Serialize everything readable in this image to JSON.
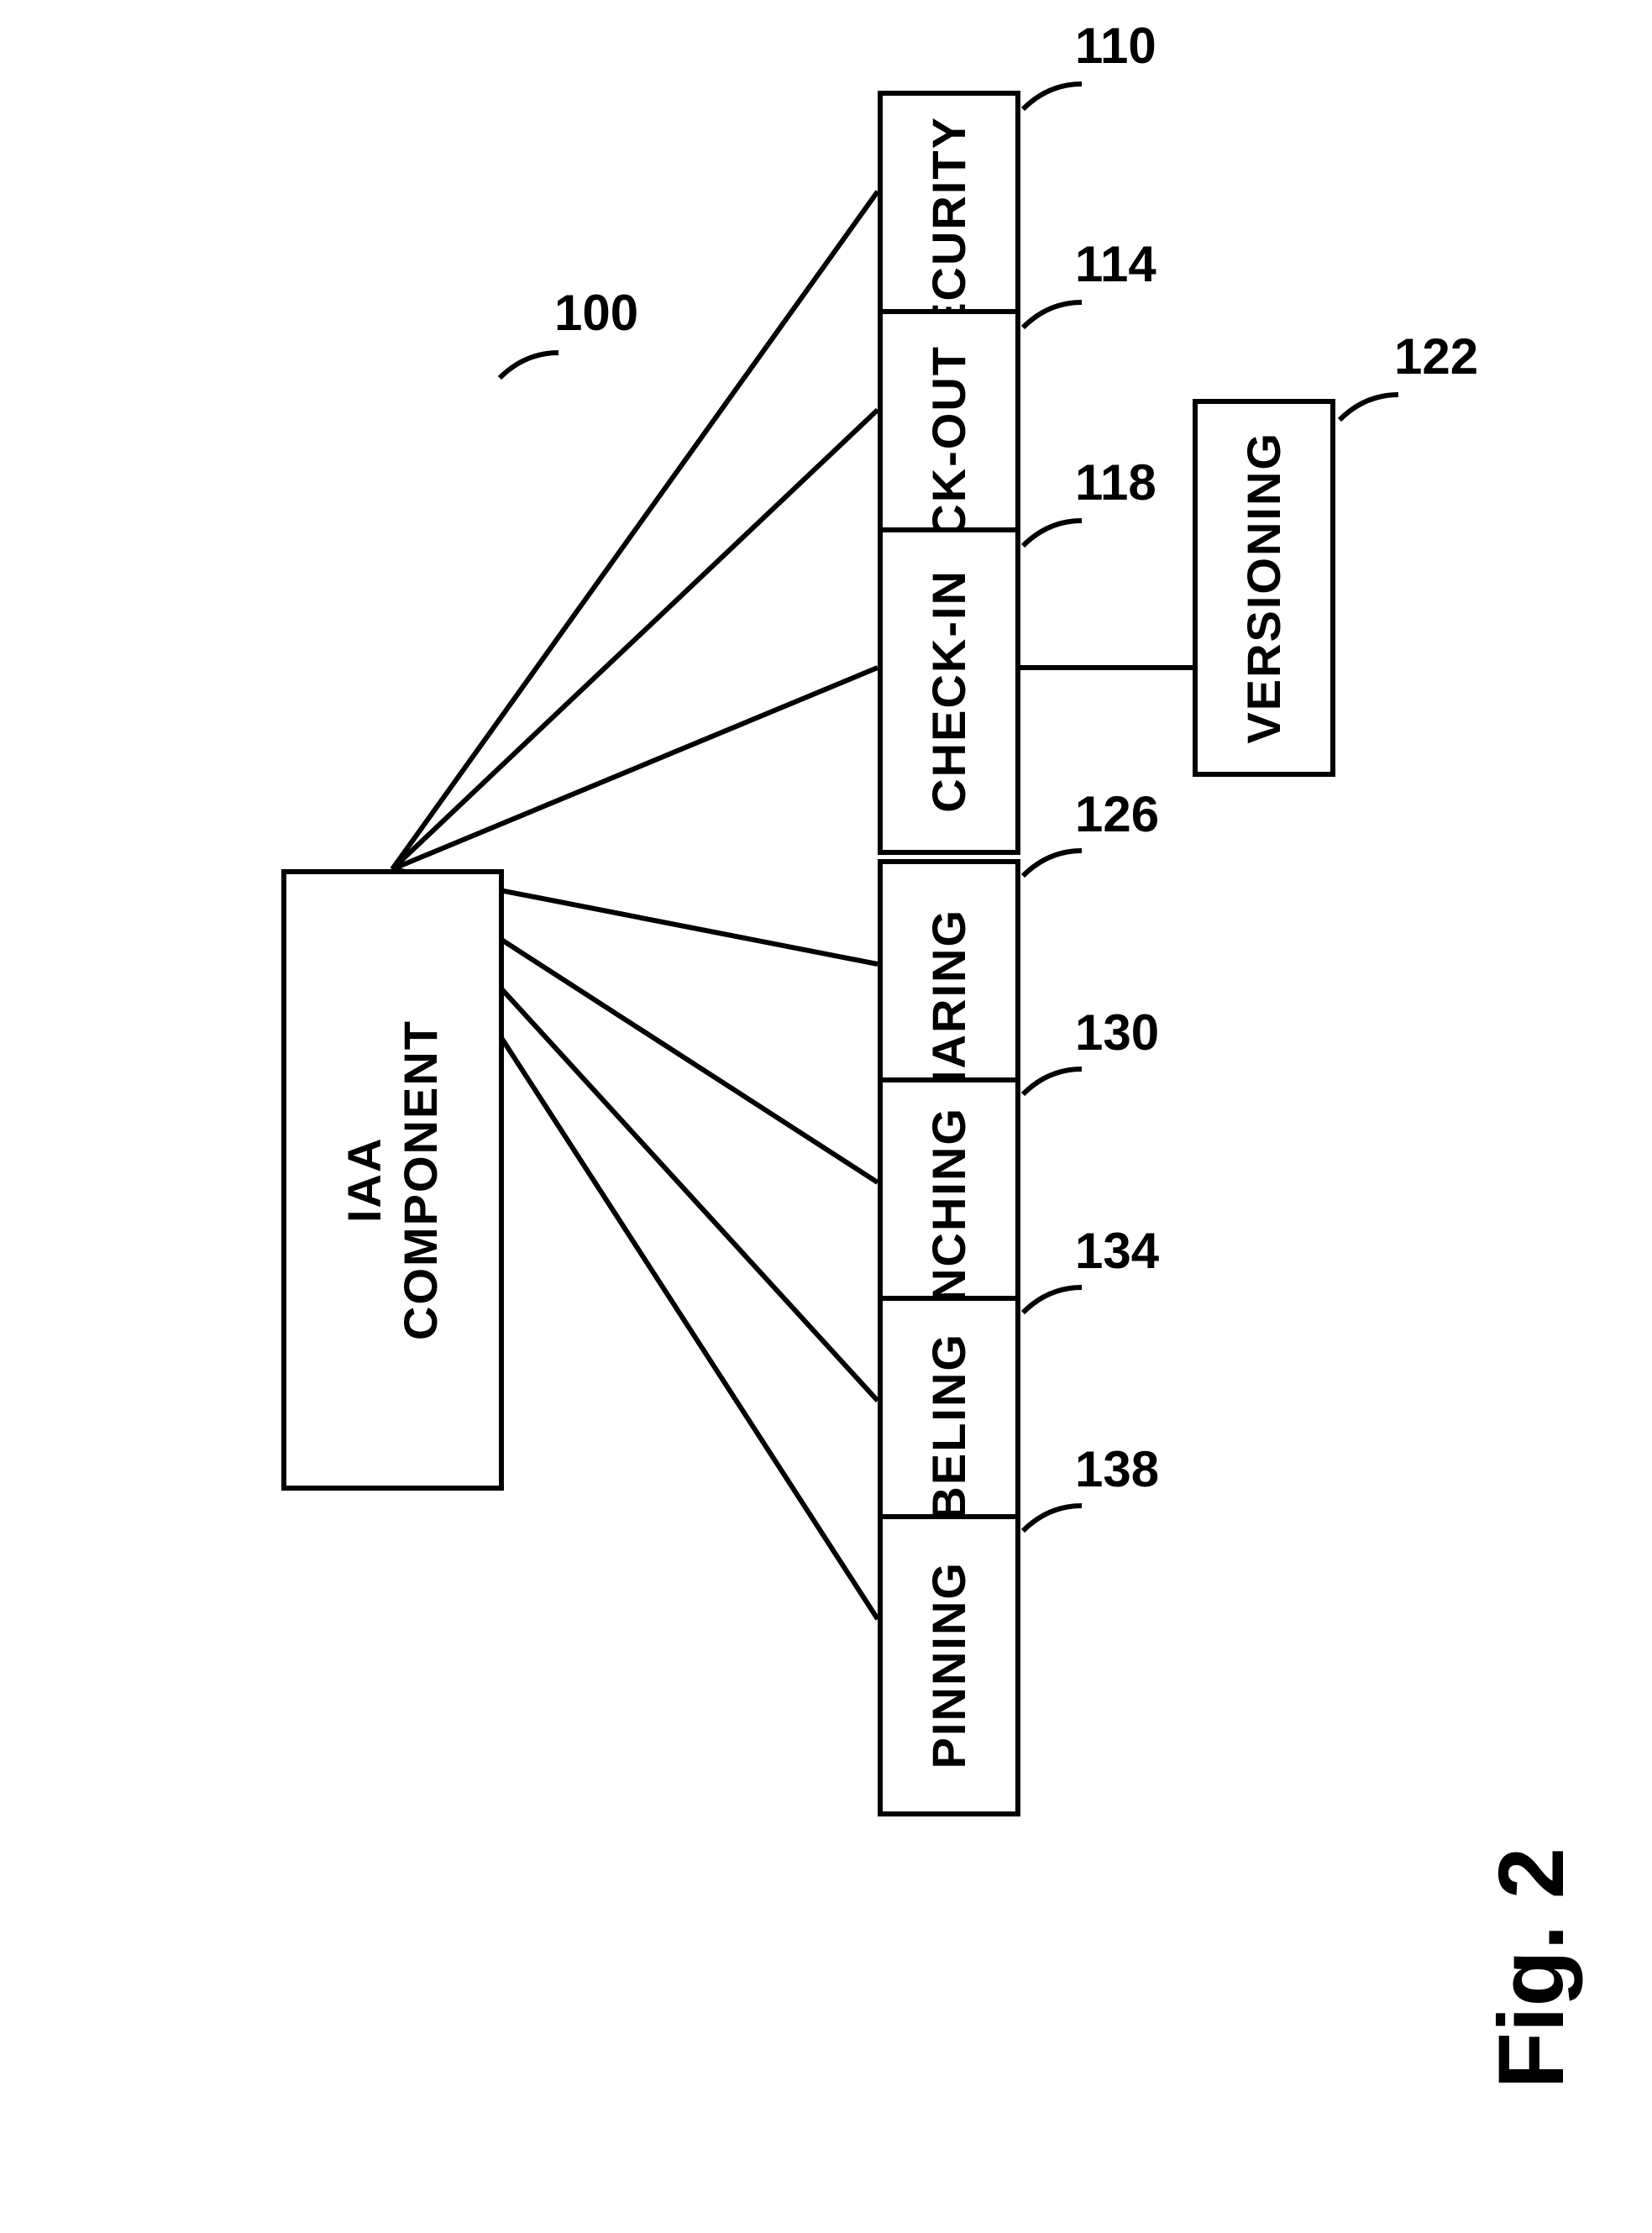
{
  "figure_label": "Fig. 2",
  "main": {
    "label": "IAA\nCOMPONENT",
    "ref": "100"
  },
  "nodes": [
    {
      "label": "USER SECURITY",
      "ref": "110"
    },
    {
      "label": "CHECK-OUT",
      "ref": "114"
    },
    {
      "label": "CHECK-IN",
      "ref": "118"
    },
    {
      "label": "SHARING",
      "ref": "126"
    },
    {
      "label": "BRANCHING",
      "ref": "130"
    },
    {
      "label": "LABELING",
      "ref": "134"
    },
    {
      "label": "PINNING",
      "ref": "138"
    }
  ],
  "side_node": {
    "label": "VERSIONING",
    "ref": "122"
  }
}
